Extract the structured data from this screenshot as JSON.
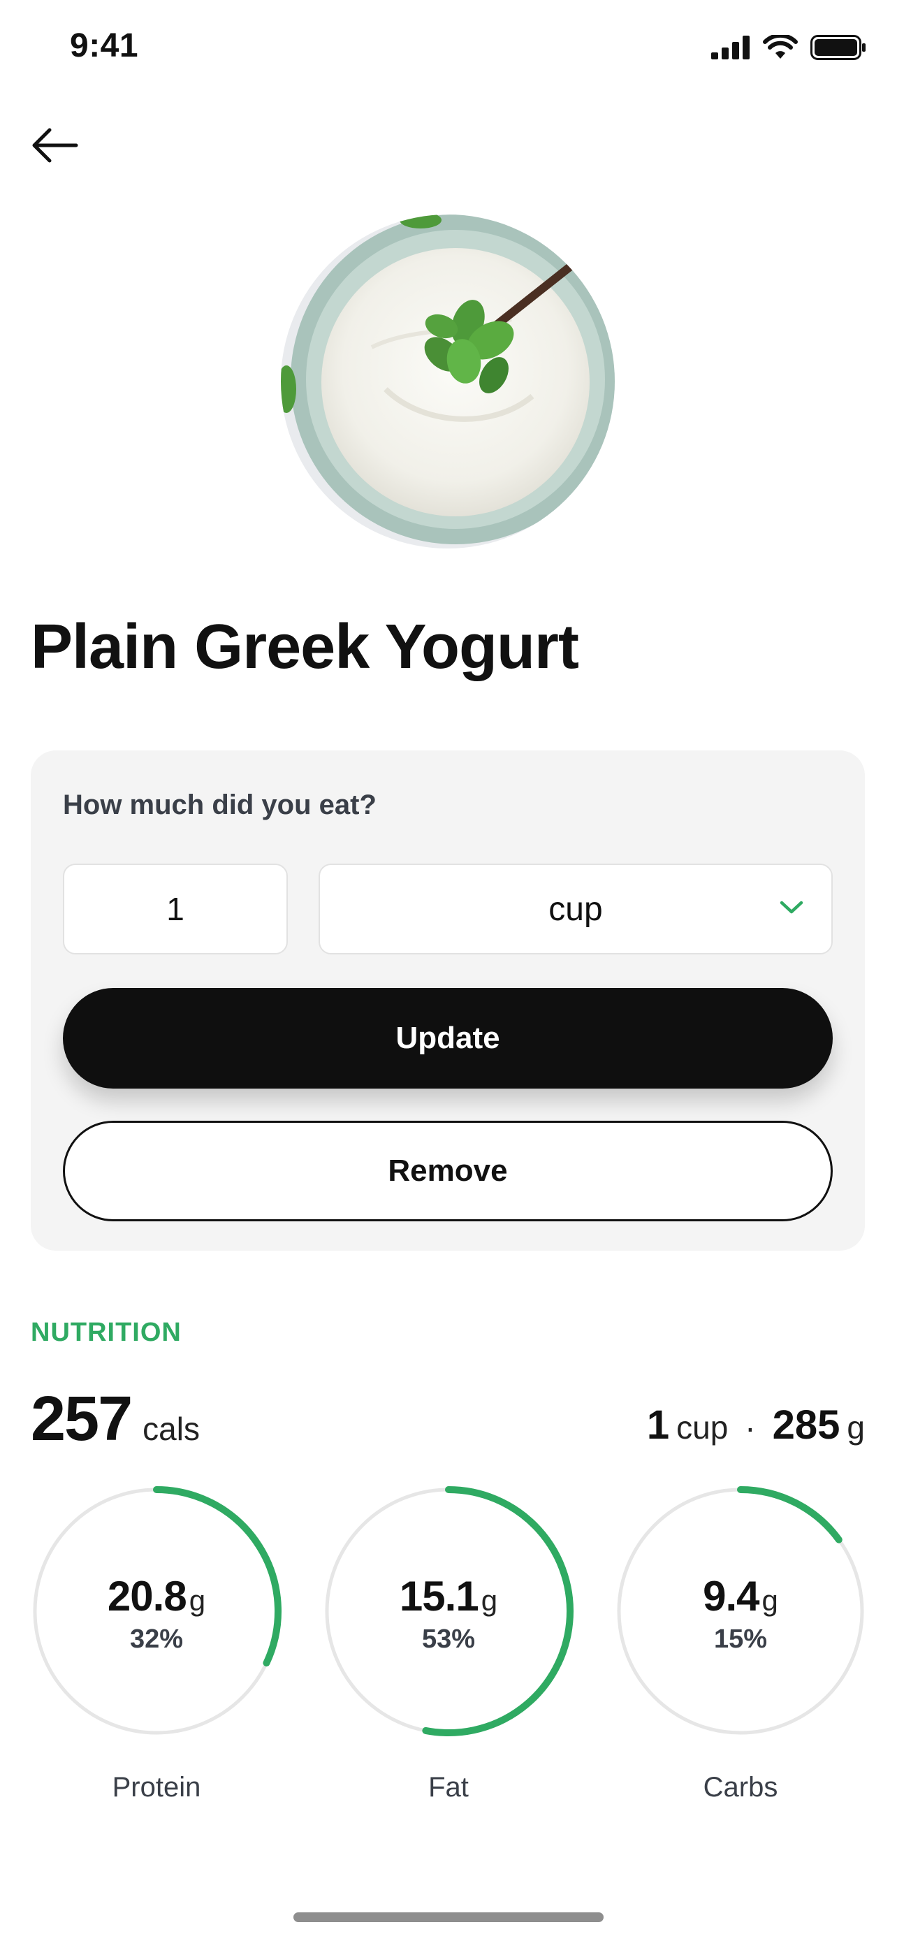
{
  "status_bar": {
    "time": "9:41"
  },
  "food": {
    "title": "Plain Greek Yogurt"
  },
  "portion": {
    "question": "How much did you eat?",
    "quantity": "1",
    "unit": "cup",
    "update_label": "Update",
    "remove_label": "Remove"
  },
  "nutrition": {
    "heading": "NUTRITION",
    "calories_value": "257",
    "calories_unit": "cals",
    "serving_qty": "1",
    "serving_unit": "cup",
    "serving_separator": "·",
    "weight_value": "285",
    "weight_unit": "g",
    "macros": [
      {
        "label": "Protein",
        "value": "20.8",
        "unit": "g",
        "percent_label": "32%",
        "percent": 32
      },
      {
        "label": "Fat",
        "value": "15.1",
        "unit": "g",
        "percent_label": "53%",
        "percent": 53
      },
      {
        "label": "Carbs",
        "value": "9.4",
        "unit": "g",
        "percent_label": "15%",
        "percent": 15
      }
    ]
  },
  "colors": {
    "accent": "#2faa62",
    "ring_track": "#e6e6e6",
    "button_dark": "#0f0f0f",
    "card_background": "#f4f4f4"
  },
  "icons": {
    "back": "arrow-left-icon",
    "unit_dropdown": "chevron-down-icon",
    "signal": "cellular-signal-icon",
    "wifi": "wifi-icon",
    "battery": "battery-icon"
  }
}
